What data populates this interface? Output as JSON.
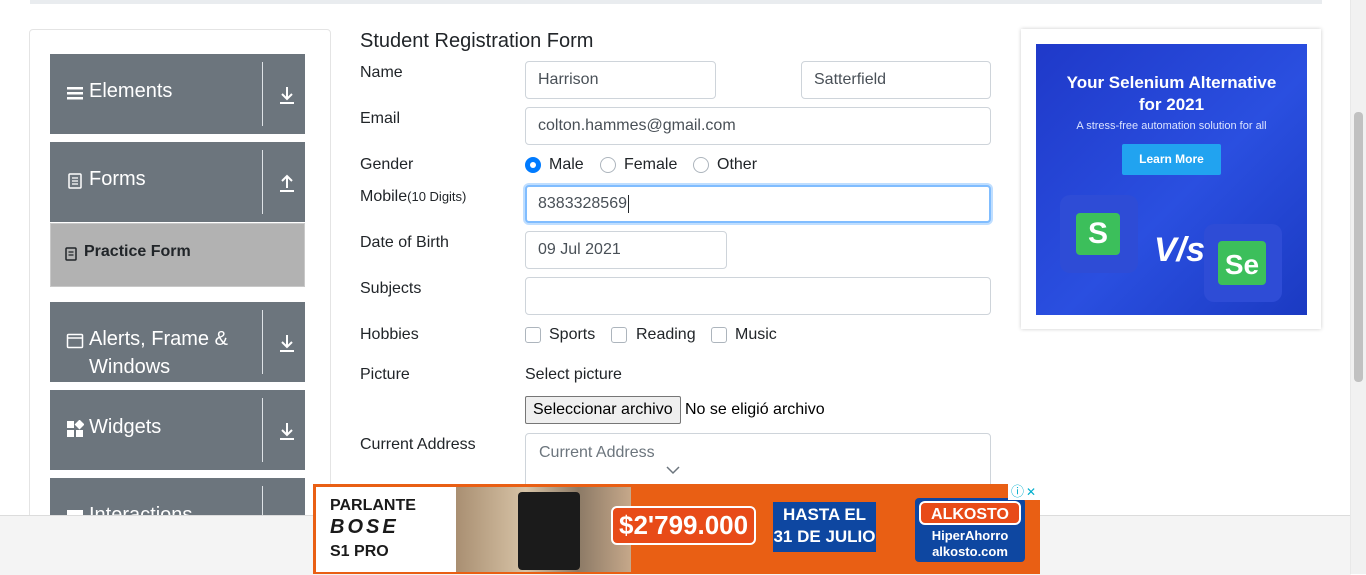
{
  "sidebar": {
    "groups": [
      {
        "label": "Elements"
      },
      {
        "label": "Forms"
      },
      {
        "label": "Alerts, Frame &",
        "label2": "Windows"
      },
      {
        "label": "Widgets"
      },
      {
        "label": "Interactions"
      }
    ],
    "active_item": "Practice Form"
  },
  "form": {
    "title": "Student Registration Form",
    "name_label": "Name",
    "first_name": "Harrison",
    "last_name": "Satterfield",
    "email_label": "Email",
    "email": "colton.hammes@gmail.com",
    "gender_label": "Gender",
    "gender_options": [
      "Male",
      "Female",
      "Other"
    ],
    "gender_selected": "Male",
    "mobile_label": "Mobile",
    "mobile_hint": "(10 Digits)",
    "mobile": "8383328569",
    "dob_label": "Date of Birth",
    "dob": "09 Jul 2021",
    "subjects_label": "Subjects",
    "subjects_value": "",
    "hobbies_label": "Hobbies",
    "hobbies": [
      "Sports",
      "Reading",
      "Music"
    ],
    "picture_label": "Picture",
    "select_picture": "Select picture",
    "file_button": "Seleccionar archivo",
    "file_status": "No se eligió archivo",
    "address_label": "Current Address",
    "address_placeholder": "Current Address"
  },
  "ad_right": {
    "title_line1": "Your Selenium Alternative",
    "title_line2": "for 2021",
    "subtitle": "A stress-free automation solution for all",
    "button": "Learn More",
    "vs": "V/s",
    "logo_left": "S",
    "logo_right": "Se"
  },
  "ad_bottom": {
    "line1": "PARLANTE",
    "brand": "BOSE",
    "model": "S1 PRO",
    "price": "$2'799.000",
    "promo_line1": "HASTA EL",
    "promo_line2": "31 DE JULIO",
    "store": "ALKOSTO",
    "store_sub": "HiperAhorro",
    "store_url": "alkosto.com",
    "info_icon": "ⓘ",
    "close_icon": "✕"
  }
}
